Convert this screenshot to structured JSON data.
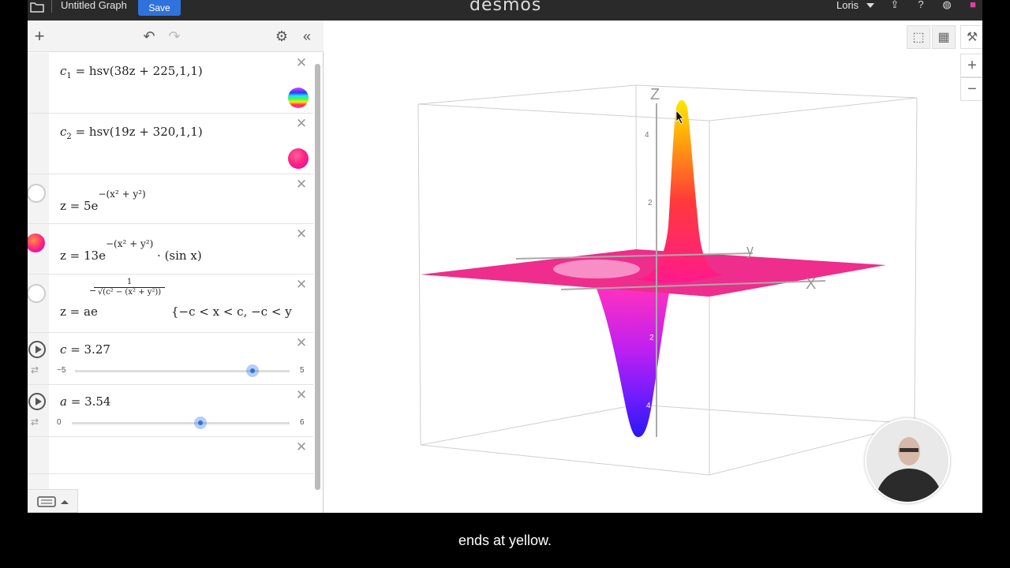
{
  "topbar": {
    "title": "Untitled Graph",
    "save_label": "Save",
    "brand": "desmos",
    "user": "Loris"
  },
  "expressions": [
    {
      "lhs": "c",
      "sub": "1",
      "rhs": "= hsv(38z + 225,1,1)",
      "swatch": "hue-rainbow"
    },
    {
      "lhs": "c",
      "sub": "2",
      "rhs": "= hsv(19z + 320,1,1)",
      "swatch": "magenta"
    },
    {
      "text": "z = 5e",
      "exponent": "−(x² + y²)"
    },
    {
      "text": "z = 13e",
      "exponent": "−(x² + y²)",
      "tail": "· (sin x)"
    },
    {
      "text": "z = ae",
      "exponent_num": "1",
      "exponent_den": "√(c² − (x² + y²))",
      "tail": "{−c < x < c, −c < y"
    },
    {
      "var": "c",
      "value": "= 3.27",
      "min": "−5",
      "max": "5",
      "fraction": 0.827
    },
    {
      "var": "a",
      "value": "= 3.54",
      "min": "0",
      "max": "6",
      "fraction": 0.59
    }
  ],
  "axes": {
    "x": "X",
    "y": "y",
    "z": "Z",
    "ticks_z": [
      "4",
      "2",
      "2",
      "4"
    ]
  },
  "caption": "ends at yellow.",
  "colors": {
    "accent": "#2f72dc",
    "plane": "#ee2d8c",
    "peak_top": "#ffe800",
    "well_bottom": "#3a1cff"
  }
}
